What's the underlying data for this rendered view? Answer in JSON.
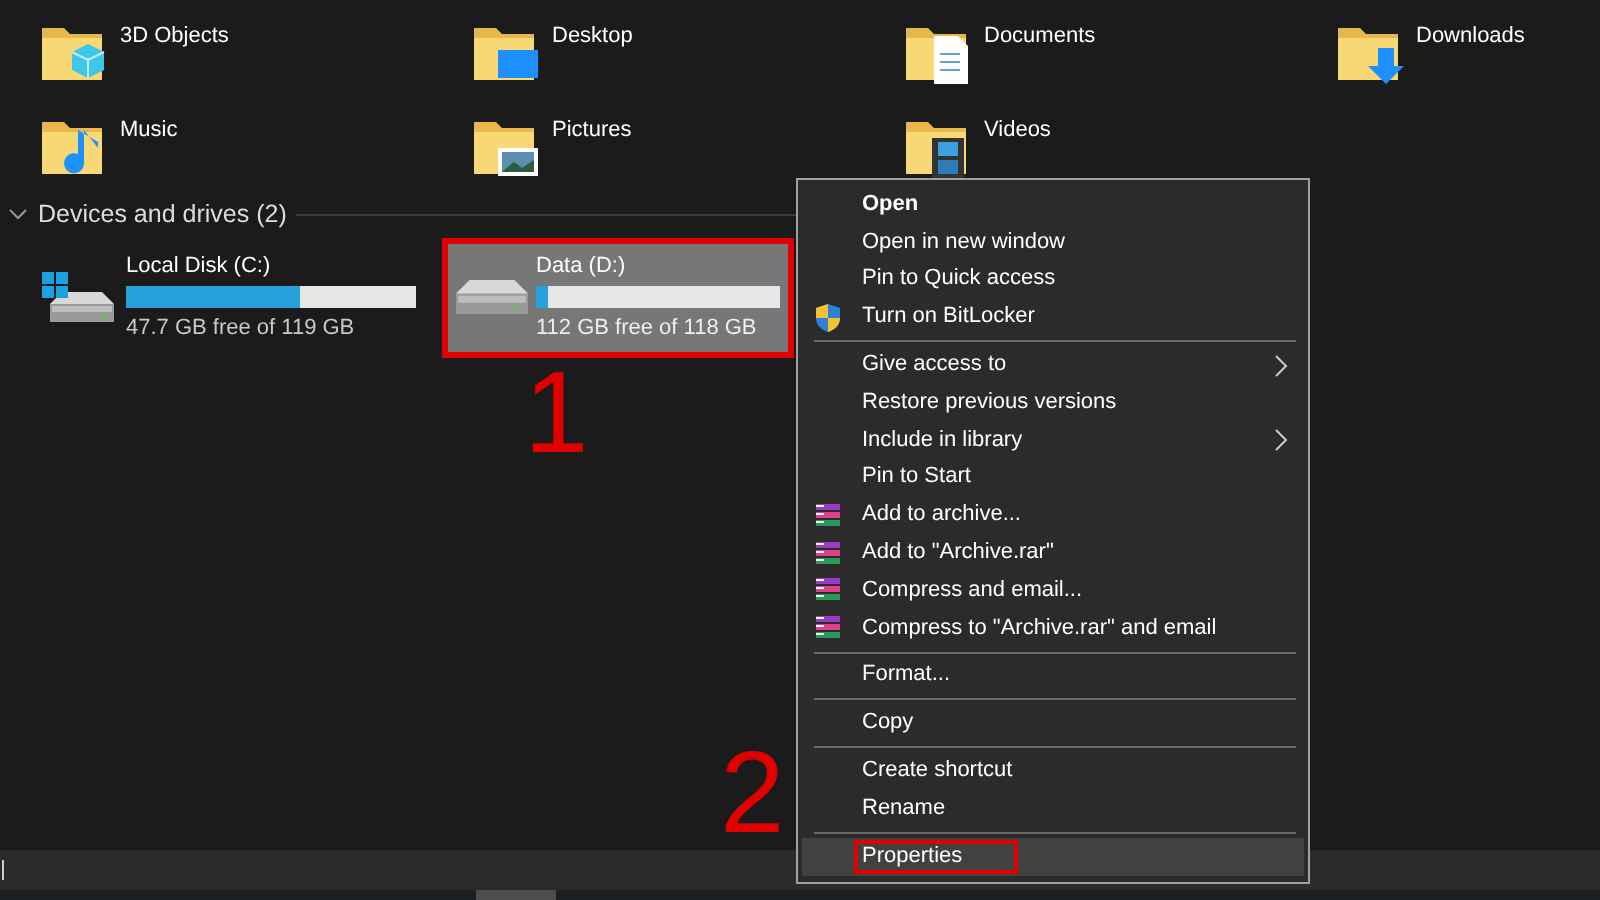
{
  "folders": [
    {
      "name": "3D Objects",
      "kind": "objects3d"
    },
    {
      "name": "Desktop",
      "kind": "desktop"
    },
    {
      "name": "Documents",
      "kind": "documents"
    },
    {
      "name": "Downloads",
      "kind": "downloads"
    },
    {
      "name": "Music",
      "kind": "music"
    },
    {
      "name": "Pictures",
      "kind": "pictures"
    },
    {
      "name": "Videos",
      "kind": "videos"
    }
  ],
  "devices_section": {
    "title": "Devices and drives (2)",
    "expanded": true
  },
  "drives": [
    {
      "name": "Local Disk (C:)",
      "free": "47.7 GB free of 119 GB",
      "level": 0.6,
      "kind": "system",
      "selected": false,
      "annotated": false
    },
    {
      "name": "Data (D:)",
      "free": "112 GB free of 118 GB",
      "level": 0.05,
      "kind": "plain",
      "selected": true,
      "annotated": true
    }
  ],
  "context_menu": [
    {
      "kind": "item",
      "label": "Open",
      "bold": true,
      "selected": false,
      "annotated": false
    },
    {
      "kind": "item",
      "label": "Open in new window",
      "selected": false,
      "annotated": false
    },
    {
      "kind": "item",
      "label": "Pin to Quick access",
      "selected": false,
      "annotated": false
    },
    {
      "kind": "shield",
      "label": "Turn on BitLocker",
      "selected": false,
      "annotated": false
    },
    {
      "kind": "separator"
    },
    {
      "kind": "item",
      "label": "Give access to",
      "submenu": true,
      "selected": false,
      "annotated": false
    },
    {
      "kind": "item",
      "label": "Restore previous versions",
      "selected": false,
      "annotated": false
    },
    {
      "kind": "item",
      "label": "Include in library",
      "submenu": true,
      "selected": false,
      "annotated": false
    },
    {
      "kind": "item",
      "label": "Pin to Start",
      "selected": false,
      "annotated": false
    },
    {
      "kind": "archive",
      "label": "Add to archive...",
      "selected": false,
      "annotated": false
    },
    {
      "kind": "archive",
      "label": "Add to \"Archive.rar\"",
      "selected": false,
      "annotated": false
    },
    {
      "kind": "archive",
      "label": "Compress and email...",
      "selected": false,
      "annotated": false
    },
    {
      "kind": "archive",
      "label": "Compress to \"Archive.rar\" and email",
      "selected": false,
      "annotated": false
    },
    {
      "kind": "separator"
    },
    {
      "kind": "item",
      "label": "Format...",
      "selected": false,
      "annotated": false
    },
    {
      "kind": "separator"
    },
    {
      "kind": "item",
      "label": "Copy",
      "selected": false,
      "annotated": false
    },
    {
      "kind": "separator"
    },
    {
      "kind": "item",
      "label": "Create shortcut",
      "selected": false,
      "annotated": false
    },
    {
      "kind": "item",
      "label": "Rename",
      "selected": false,
      "annotated": false
    },
    {
      "kind": "separator"
    },
    {
      "kind": "item",
      "label": "Properties",
      "selected": true,
      "annotated": true
    }
  ],
  "step_numbers": [
    "1",
    "2"
  ]
}
